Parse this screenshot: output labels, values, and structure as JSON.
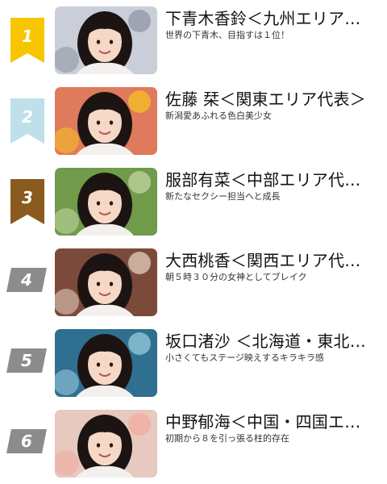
{
  "ranking": [
    {
      "rank": "1",
      "badge_color": "#f7c600",
      "badge_shape": "banner",
      "title": "下青木香鈴＜九州エリア…",
      "subtitle": "世界の下青木、目指すは１位！",
      "photo_bg": "#c9ced8",
      "photo_accent": "#8b93a3"
    },
    {
      "rank": "2",
      "badge_color": "#bfe0ea",
      "badge_shape": "banner",
      "title": "佐藤 栞＜関東エリア代表＞",
      "subtitle": "新潟愛あふれる色白美少女",
      "photo_bg": "#e07a5c",
      "photo_accent": "#f6c521"
    },
    {
      "rank": "3",
      "badge_color": "#8a5a1e",
      "badge_shape": "banner",
      "title": "服部有菜＜中部エリア代…",
      "subtitle": "新たなセクシー担当へと成長",
      "photo_bg": "#6f9b4a",
      "photo_accent": "#c7d9a6"
    },
    {
      "rank": "4",
      "badge_color": "#8c8c8c",
      "badge_shape": "tag",
      "title": "大西桃香＜関西エリア代…",
      "subtitle": "朝５時３０分の女神としてブレイク",
      "photo_bg": "#7c4a3b",
      "photo_accent": "#e9d7c7"
    },
    {
      "rank": "5",
      "badge_color": "#8c8c8c",
      "badge_shape": "tag",
      "title": "坂口渚沙 ＜北海道・東北…",
      "subtitle": "小さくてもステージ映えするキラキラ感",
      "photo_bg": "#2f6f8f",
      "photo_accent": "#9ed1e3"
    },
    {
      "rank": "6",
      "badge_color": "#8c8c8c",
      "badge_shape": "tag",
      "title": "中野郁海＜中国・四国エ…",
      "subtitle": "初期から８を引っ張る柱的存在",
      "photo_bg": "#e7c9c0",
      "photo_accent": "#f3a99b"
    }
  ]
}
